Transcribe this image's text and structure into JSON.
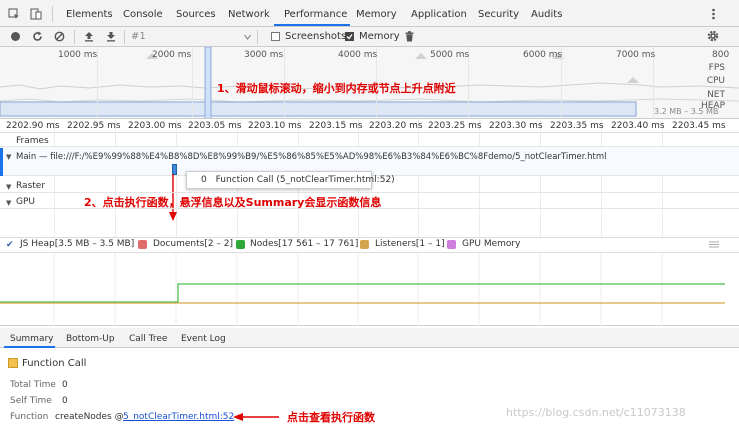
{
  "tabs": [
    "Elements",
    "Console",
    "Sources",
    "Network",
    "Performance",
    "Memory",
    "Application",
    "Security",
    "Audits"
  ],
  "active_tab": "Performance",
  "toolbar": {
    "profile_select": "#1",
    "screenshots_label": "Screenshots",
    "memory_label": "Memory",
    "screenshots_checked": false,
    "memory_checked": true
  },
  "overview": {
    "ticks": [
      "1000 ms",
      "2000 ms",
      "3000 ms",
      "4000 ms",
      "5000 ms",
      "6000 ms",
      "7000 ms",
      "800"
    ],
    "labels": [
      "FPS",
      "CPU",
      "NET",
      "HEAP"
    ],
    "heap_range": "3.2 MB – 3.5 MB"
  },
  "ruler": {
    "ticks": [
      "2202.90 ms",
      "2202.95 ms",
      "2203.00 ms",
      "2203.05 ms",
      "2203.10 ms",
      "2203.15 ms",
      "2203.20 ms",
      "2203.25 ms",
      "2203.30 ms",
      "2203.35 ms",
      "2203.40 ms",
      "2203.45 ms"
    ]
  },
  "tracks": {
    "frames": "Frames",
    "main": "Main — file:///F:/%E9%99%88%E4%B8%8D%E8%99%B9/%E5%86%85%E5%AD%98%E6%B3%84%E6%BC%8Fdemo/5_notClearTimer.html",
    "raster": "Raster",
    "gpu": "GPU"
  },
  "tooltip": {
    "duration": "0",
    "text": "Function Call (5_notClearTimer.html:52)"
  },
  "legend": [
    {
      "label": "JS Heap[3.5 MB – 3.5 MB]",
      "color": "#2d5fb8",
      "checked": true
    },
    {
      "label": "Documents[2 – 2]",
      "color": "#e06c6c",
      "checked": true
    },
    {
      "label": "Nodes[17 561 – 17 761]",
      "color": "#2ea836",
      "checked": true
    },
    {
      "label": "Listeners[1 – 1]",
      "color": "#d4a64b",
      "checked": true
    },
    {
      "label": "GPU Memory",
      "color": "#d07ee0",
      "checked": true
    }
  ],
  "bottom_tabs": [
    "Summary",
    "Bottom-Up",
    "Call Tree",
    "Event Log"
  ],
  "summary": {
    "title": "Function Call",
    "title_color": "#f2c04c",
    "total_time_label": "Total Time",
    "total_time": "0",
    "self_time_label": "Self Time",
    "self_time": "0",
    "function_label": "Function",
    "function_name": "createNodes @",
    "function_link": "5_notClearTimer.html:52"
  },
  "annotations": {
    "a1": "1、滑动鼠标滚动，缩小到内存或节点上升点附近",
    "a2": "2、点击执行函数，悬浮信息以及Summary会显示函数信息",
    "a3": "点击查看执行函数"
  },
  "watermark": "https://blog.csdn.net/c11073138",
  "icons": [
    "cursor-icon",
    "device-icon",
    "record-icon",
    "reload-icon",
    "clear-icon",
    "upload-icon",
    "download-icon",
    "trash-icon",
    "settings-icon",
    "more-icon"
  ]
}
